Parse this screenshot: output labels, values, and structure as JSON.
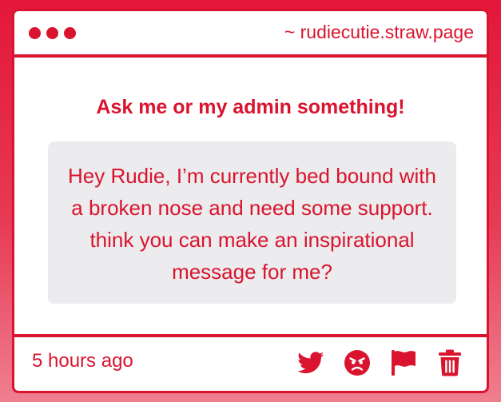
{
  "window": {
    "url": "~ rudiecutie.straw.page"
  },
  "main": {
    "prompt": "Ask me or my admin something!",
    "question": "Hey Rudie, I’m currently bed bound with a broken nose and need some support. think you can make an inspirational message for me?"
  },
  "footer": {
    "timestamp": "5 hours ago",
    "actions": [
      "twitter-icon",
      "angry-face-icon",
      "flag-icon",
      "trash-icon"
    ]
  },
  "colors": {
    "accent": "#d9142f",
    "question_bg": "#ecebed",
    "background_top": "#e3173a",
    "background_bottom": "#ef7f8f"
  }
}
